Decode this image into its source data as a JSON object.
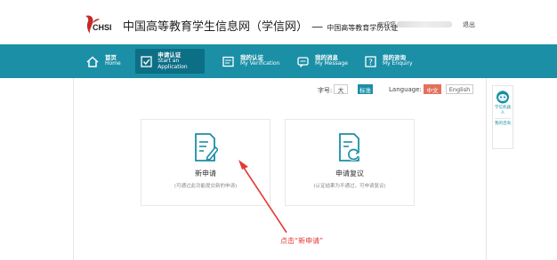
{
  "header": {
    "logo_text": "CHSI",
    "site_title": "中国高等教育学生信息网（学信网）",
    "separator": "—",
    "site_subtitle": "中国高等教育学历认证",
    "welcome": "欢迎您,",
    "logout": "退出"
  },
  "nav": {
    "items": [
      {
        "zh": "首页",
        "en": "Home",
        "icon": "home-icon",
        "active": false
      },
      {
        "zh": "申请认证",
        "en": "Start an Application",
        "icon": "checkbox-icon",
        "active": true
      },
      {
        "zh": "我的认证",
        "en": "My Verification",
        "icon": "document-icon",
        "active": false
      },
      {
        "zh": "我的消息",
        "en": "My Message",
        "icon": "message-icon",
        "active": false
      },
      {
        "zh": "我的咨询",
        "en": "My Enquiry",
        "icon": "question-icon",
        "active": false
      }
    ]
  },
  "toolbar": {
    "fontsize_label": "字号:",
    "font_large": "大",
    "font_standard": "标准",
    "language_label": "Language:",
    "lang_zh": "中文",
    "lang_en": "English"
  },
  "cards": [
    {
      "title": "新申请",
      "subtitle": "(可通过此功能提交新的申请)",
      "icon": "edit-document-icon"
    },
    {
      "title": "申请复议",
      "subtitle": "(认证结果为不通过，可申请复议)",
      "icon": "refresh-document-icon"
    }
  ],
  "annotation": "点击“新申请”",
  "sidebar": {
    "robot_label": "学信机器人",
    "consult_label": "我的咨询"
  },
  "colors": {
    "nav_bg": "#1a8fa6",
    "nav_active": "#0d6f86",
    "accent_red": "#e53935",
    "lang_active": "#e2725b"
  }
}
